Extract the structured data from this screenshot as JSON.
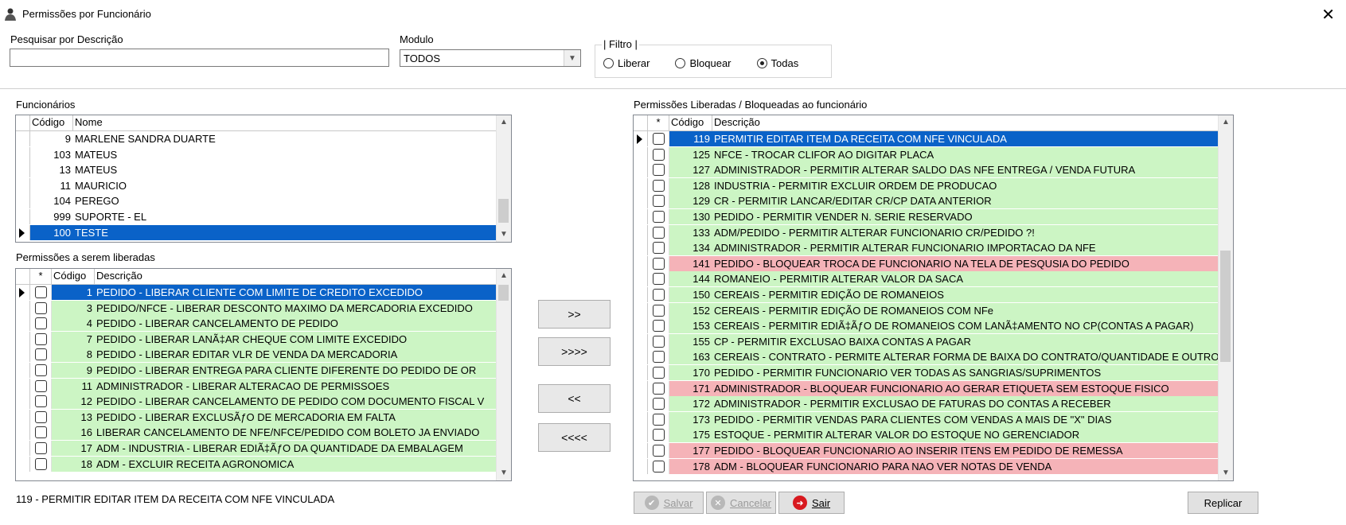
{
  "window": {
    "title": "Permissões por Funcionário"
  },
  "search": {
    "label": "Pesquisar por Descrição",
    "value": ""
  },
  "module": {
    "label": "Modulo",
    "value": "TODOS"
  },
  "filter": {
    "legend": "| Filtro |",
    "options": [
      "Liberar",
      "Bloquear",
      "Todas"
    ],
    "selected": "Todas"
  },
  "employees": {
    "label": "Funcionários",
    "headers": [
      "Código",
      "Nome"
    ],
    "rows": [
      {
        "code": "9",
        "name": "MARLENE SANDRA DUARTE"
      },
      {
        "code": "103",
        "name": "MATEUS"
      },
      {
        "code": "13",
        "name": "MATEUS"
      },
      {
        "code": "11",
        "name": "MAURICIO"
      },
      {
        "code": "104",
        "name": "PEREGO"
      },
      {
        "code": "999",
        "name": "SUPORTE - EL"
      },
      {
        "code": "100",
        "name": "TESTE"
      }
    ],
    "selected_index": 6
  },
  "to_release": {
    "label": "Permissões a serem liberadas",
    "headers": [
      "*",
      "Código",
      "Descrição"
    ],
    "rows": [
      {
        "code": "1",
        "desc": "PEDIDO - LIBERAR CLIENTE COM LIMITE DE CREDITO EXCEDIDO"
      },
      {
        "code": "3",
        "desc": "PEDIDO/NFCE - LIBERAR DESCONTO MAXIMO DA MERCADORIA EXCEDIDO"
      },
      {
        "code": "4",
        "desc": "PEDIDO - LIBERAR CANCELAMENTO DE PEDIDO"
      },
      {
        "code": "7",
        "desc": "PEDIDO - LIBERAR LANÃ‡AR CHEQUE COM LIMITE EXCEDIDO"
      },
      {
        "code": "8",
        "desc": "PEDIDO - LIBERAR EDITAR VLR DE VENDA DA MERCADORIA"
      },
      {
        "code": "9",
        "desc": "PEDIDO - LIBERAR ENTREGA PARA CLIENTE DIFERENTE DO PEDIDO DE OR"
      },
      {
        "code": "11",
        "desc": "ADMINISTRADOR - LIBERAR ALTERACAO DE PERMISSOES"
      },
      {
        "code": "12",
        "desc": "PEDIDO - LIBERAR CANCELAMENTO DE PEDIDO COM DOCUMENTO FISCAL V"
      },
      {
        "code": "13",
        "desc": "PEDIDO - LIBERAR EXCLUSÃƒO DE MERCADORIA EM FALTA"
      },
      {
        "code": "16",
        "desc": "LIBERAR CANCELAMENTO DE NFE/NFCE/PEDIDO COM BOLETO JA ENVIADO"
      },
      {
        "code": "17",
        "desc": "ADM - INDUSTRIA - LIBERAR EDIÃ‡ÃƒO DA QUANTIDADE DA EMBALAGEM"
      },
      {
        "code": "18",
        "desc": "ADM - EXCLUIR RECEITA AGRONOMICA"
      }
    ],
    "selected_index": 0
  },
  "transfer_buttons": [
    ">>",
    ">>>>",
    "<<",
    "<<<<"
  ],
  "status_text": "119 - PERMITIR EDITAR ITEM DA RECEITA COM NFE VINCULADA",
  "assigned": {
    "label": "Permissões Liberadas / Bloqueadas ao funcionário",
    "headers": [
      "*",
      "Código",
      "Descrição"
    ],
    "rows": [
      {
        "code": "119",
        "desc": "PERMITIR EDITAR ITEM DA RECEITA COM NFE VINCULADA",
        "state": "selected"
      },
      {
        "code": "125",
        "desc": "NFCE - TROCAR CLIFOR AO DIGITAR PLACA",
        "state": "liberada"
      },
      {
        "code": "127",
        "desc": "ADMINISTRADOR - PERMITIR ALTERAR SALDO DAS NFE ENTREGA / VENDA FUTURA",
        "state": "liberada"
      },
      {
        "code": "128",
        "desc": "INDUSTRIA - PERMITIR EXCLUIR ORDEM DE PRODUCAO",
        "state": "liberada"
      },
      {
        "code": "129",
        "desc": "CR - PERMITIR LANCAR/EDITAR CR/CP DATA ANTERIOR",
        "state": "liberada"
      },
      {
        "code": "130",
        "desc": "PEDIDO - PERMITIR VENDER N. SERIE RESERVADO",
        "state": "liberada"
      },
      {
        "code": "133",
        "desc": "ADM/PEDIDO - PERMITIR ALTERAR FUNCIONARIO CR/PEDIDO ?!",
        "state": "liberada"
      },
      {
        "code": "134",
        "desc": "ADMINISTRADOR - PERMITIR ALTERAR FUNCIONARIO IMPORTACAO DA NFE",
        "state": "liberada"
      },
      {
        "code": "141",
        "desc": "PEDIDO - BLOQUEAR TROCA DE FUNCIONARIO NA TELA DE PESQUSIA DO PEDIDO",
        "state": "bloqueada"
      },
      {
        "code": "144",
        "desc": "ROMANEIO - PERMITIR ALTERAR VALOR DA SACA",
        "state": "liberada"
      },
      {
        "code": "150",
        "desc": "CEREAIS - PERMITIR EDIÇÃO DE ROMANEIOS",
        "state": "liberada"
      },
      {
        "code": "152",
        "desc": "CEREAIS - PERMITIR EDIÇÃO DE ROMANEIOS COM NFe",
        "state": "liberada"
      },
      {
        "code": "153",
        "desc": "CEREAIS - PERMITIR EDIÃ‡ÃƒO DE ROMANEIOS COM LANÃ‡AMENTO NO CP(CONTAS A PAGAR)",
        "state": "liberada"
      },
      {
        "code": "155",
        "desc": "CP - PERMITIR EXCLUSAO BAIXA CONTAS A PAGAR",
        "state": "liberada"
      },
      {
        "code": "163",
        "desc": "CEREAIS - CONTRATO - PERMITE ALTERAR FORMA DE BAIXA DO CONTRATO/QUANTIDADE E OUTRO",
        "state": "liberada"
      },
      {
        "code": "170",
        "desc": "PEDIDO - PERMITIR FUNCIONARIO VER TODAS AS SANGRIAS/SUPRIMENTOS",
        "state": "liberada"
      },
      {
        "code": "171",
        "desc": "ADMINISTRADOR - BLOQUEAR FUNCIONARIO AO GERAR ETIQUETA SEM ESTOQUE FISICO",
        "state": "bloqueada"
      },
      {
        "code": "172",
        "desc": "ADMINISTRADOR - PERMITIR EXCLUSAO DE FATURAS DO CONTAS A RECEBER",
        "state": "liberada"
      },
      {
        "code": "173",
        "desc": "PEDIDO - PERMITIR VENDAS PARA CLIENTES COM VENDAS A MAIS DE \"X\" DIAS",
        "state": "liberada"
      },
      {
        "code": "175",
        "desc": "ESTOQUE - PERMITIR ALTERAR VALOR DO ESTOQUE NO GERENCIADOR",
        "state": "liberada"
      },
      {
        "code": "177",
        "desc": "PEDIDO - BLOQUEAR FUNCIONARIO AO INSERIR ITENS EM PEDIDO DE REMESSA",
        "state": "bloqueada"
      },
      {
        "code": "178",
        "desc": "ADM - BLOQUEAR FUNCIONARIO PARA NAO VER NOTAS DE VENDA",
        "state": "bloqueada"
      }
    ]
  },
  "footer": {
    "save": "Salvar",
    "cancel": "Cancelar",
    "exit": "Sair",
    "replicate": "Replicar"
  },
  "colors": {
    "selected": "#0a62c8",
    "liberada": "#ccf5c4",
    "bloqueada": "#f5b3b8"
  }
}
